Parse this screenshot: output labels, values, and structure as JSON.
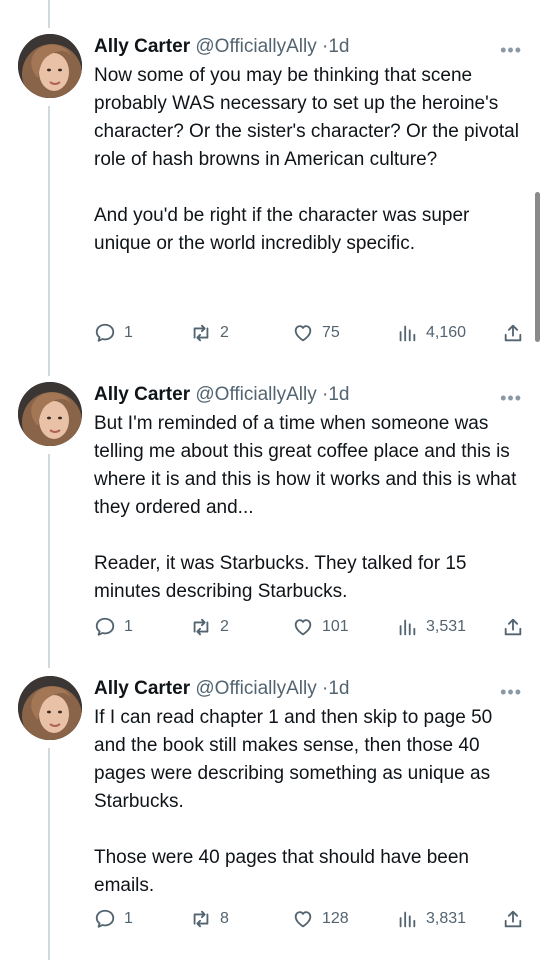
{
  "tweets": [
    {
      "name": "Ally Carter",
      "handle": "@OfficiallyAlly",
      "time": "1d",
      "paragraphs": [
        "Now some of you may be thinking that scene probably WAS necessary to set up the heroine's character? Or the sister's character? Or the pivotal role of hash browns in American culture?",
        "And you'd be right if the character was super unique or the world incredibly specific."
      ],
      "replies": "1",
      "retweets": "2",
      "likes": "75",
      "views": "4,160"
    },
    {
      "name": "Ally Carter",
      "handle": "@OfficiallyAlly",
      "time": "1d",
      "paragraphs": [
        "But I'm reminded of a time when someone was telling me about this great coffee place and this is where it is and this is how it works and this is what they ordered and...",
        "Reader, it was Starbucks. They talked for 15 minutes describing Starbucks."
      ],
      "replies": "1",
      "retweets": "2",
      "likes": "101",
      "views": "3,531"
    },
    {
      "name": "Ally Carter",
      "handle": "@OfficiallyAlly",
      "time": "1d",
      "paragraphs": [
        "If I can read chapter 1 and then skip to page 50 and the book still makes sense, then those 40 pages were describing something as unique as Starbucks.",
        "Those were 40 pages that should have been emails."
      ],
      "replies": "1",
      "retweets": "8",
      "likes": "128",
      "views": "3,831"
    }
  ],
  "ui": {
    "time_separator": "·",
    "more_label": "•••"
  },
  "colors": {
    "text": "#0f1419",
    "secondary": "#536471",
    "thread_line": "#cfd9de"
  }
}
